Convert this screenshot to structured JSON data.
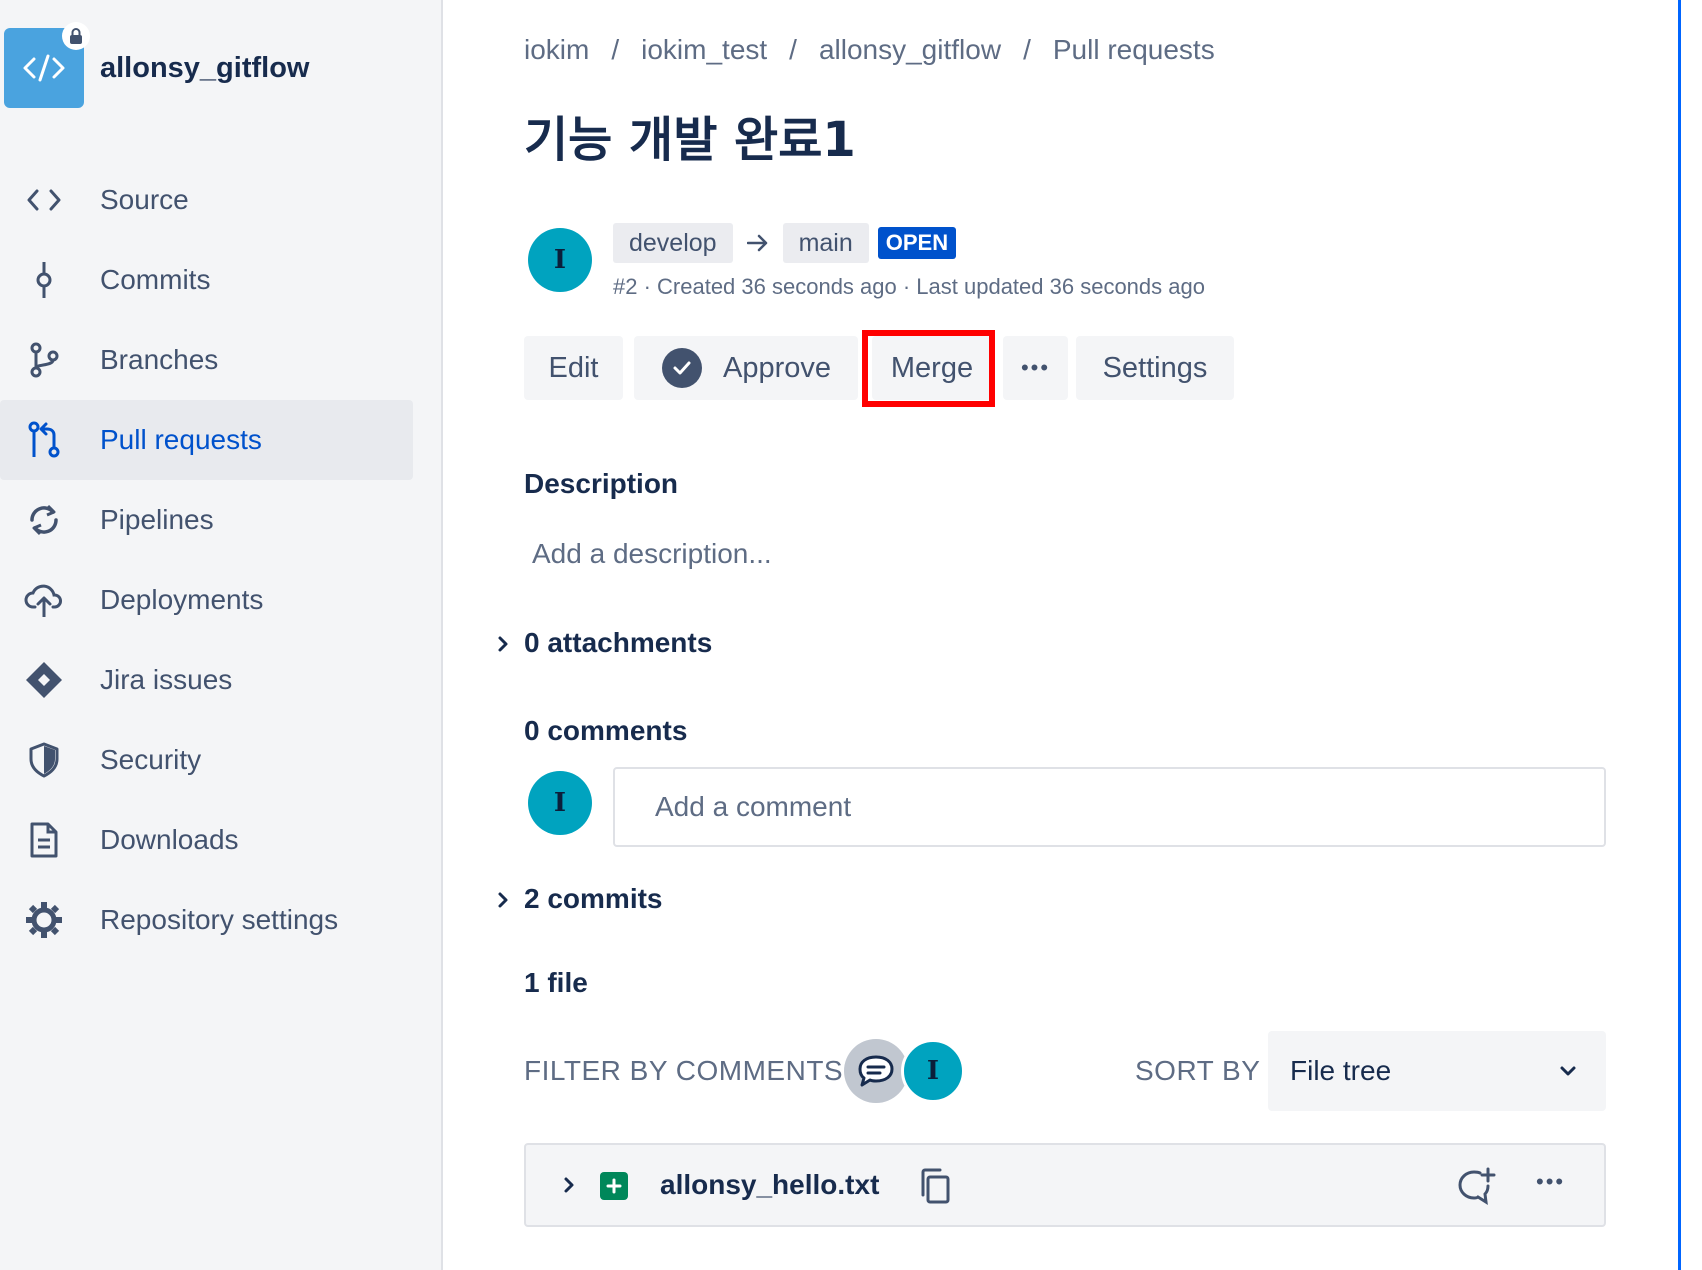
{
  "repo": {
    "name": "allonsy_gitflow"
  },
  "sidebar": {
    "items": [
      {
        "label": "Source",
        "icon": "code-icon",
        "active": false
      },
      {
        "label": "Commits",
        "icon": "commit-icon",
        "active": false
      },
      {
        "label": "Branches",
        "icon": "branch-icon",
        "active": false
      },
      {
        "label": "Pull requests",
        "icon": "pull-request-icon",
        "active": true
      },
      {
        "label": "Pipelines",
        "icon": "pipelines-icon",
        "active": false
      },
      {
        "label": "Deployments",
        "icon": "cloud-upload-icon",
        "active": false
      },
      {
        "label": "Jira issues",
        "icon": "jira-icon",
        "active": false
      },
      {
        "label": "Security",
        "icon": "shield-icon",
        "active": false
      },
      {
        "label": "Downloads",
        "icon": "document-icon",
        "active": false
      },
      {
        "label": "Repository settings",
        "icon": "gear-icon",
        "active": false
      }
    ]
  },
  "breadcrumb": [
    "iokim",
    "iokim_test",
    "allonsy_gitflow",
    "Pull requests"
  ],
  "pr": {
    "title": "기능 개발 완료1",
    "author_initial": "I",
    "source_branch": "develop",
    "target_branch": "main",
    "state": "OPEN",
    "meta": "#2 · Created 36 seconds ago · Last updated 36 seconds ago"
  },
  "actions": {
    "edit": "Edit",
    "approve": "Approve",
    "merge": "Merge",
    "more": "•••",
    "settings": "Settings"
  },
  "description": {
    "heading": "Description",
    "placeholder": "Add a description..."
  },
  "attachments": {
    "heading": "0 attachments"
  },
  "comments": {
    "heading": "0 comments",
    "user_initial": "I",
    "placeholder": "Add a comment"
  },
  "commits": {
    "heading": "2 commits"
  },
  "files": {
    "heading": "1 file",
    "filter_label": "FILTER BY COMMENTS",
    "filter_user_initial": "I",
    "sort_label": "SORT BY",
    "sort_value": "File tree",
    "items": [
      {
        "name": "allonsy_hello.txt",
        "status": "added",
        "more": "•••"
      }
    ]
  },
  "colors": {
    "accent": "#0052cc",
    "avatar": "#00a3bf",
    "added": "#00875a",
    "highlight": "#ff0000"
  }
}
